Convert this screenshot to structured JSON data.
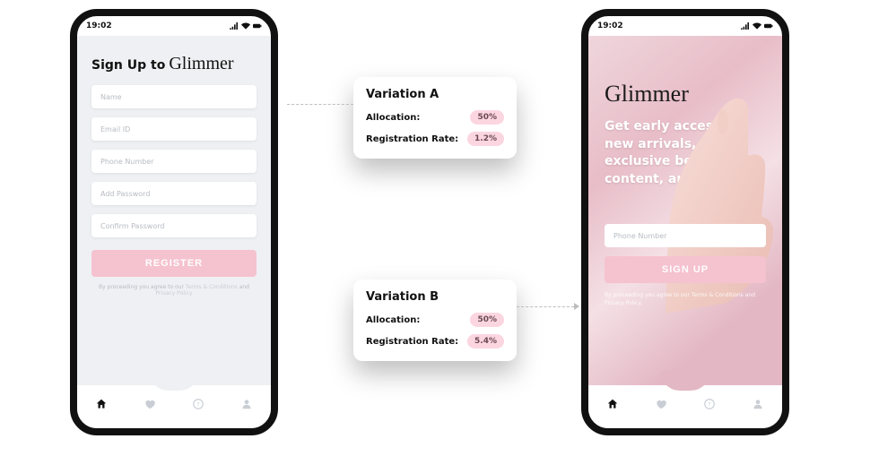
{
  "status": {
    "time": "19:02"
  },
  "nav": {
    "icons": [
      "home-icon",
      "heart-icon",
      "help-icon",
      "user-icon"
    ]
  },
  "screenA": {
    "title_prefix": "Sign Up to",
    "brand": "Glimmer",
    "fields": {
      "name": "Name",
      "email": "Email ID",
      "phone": "Phone Number",
      "pwd": "Add Password",
      "cpwd": "Confirm Password"
    },
    "register": "REGISTER",
    "legal_pre": "By proceeding you agree to our ",
    "legal_a": "Terms & Conditions",
    "legal_mid": " and ",
    "legal_b": "Privacy Policy"
  },
  "screenB": {
    "brand": "Glimmer",
    "hero": "Get early access to new arrivals, sales, exclusive beauty content, and more!",
    "phone_ph": "Phone Number",
    "signup": "SIGN UP",
    "legal": "By proceeding you agree to our Terms & Conditions and Privacy Policy."
  },
  "varA": {
    "title": "Variation A",
    "alloc_lbl": "Allocation:",
    "alloc_val": "50%",
    "rate_lbl": "Registration Rate:",
    "rate_val": "1.2%"
  },
  "varB": {
    "title": "Variation B",
    "alloc_lbl": "Allocation:",
    "alloc_val": "50%",
    "rate_lbl": "Registration Rate:",
    "rate_val": "5.4%"
  },
  "colors": {
    "pill": "#fbd6e0",
    "accent": "#f5c2cf"
  }
}
